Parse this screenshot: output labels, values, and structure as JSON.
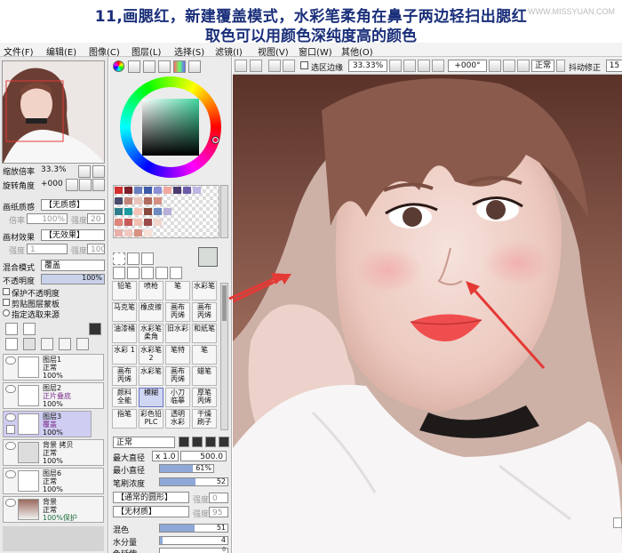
{
  "caption": {
    "line1": "11,画腮红，新建覆盖模式，水彩笔柔角在鼻子两边轻扫出腮红",
    "line2": "取色可以用颜色深纯度高的颜色",
    "watermark": "WWW.MISSYUAN.COM"
  },
  "menu": [
    "文件(F)",
    "编辑(E)",
    "图像(C)",
    "图层(L)",
    "选择(S)",
    "滤镜(I)",
    "视图(V)",
    "窗口(W)",
    "其他(O)"
  ],
  "toolbar": {
    "select_edge_label": "选区边缘",
    "zoom": "33.33%",
    "angle": "+000°",
    "mode": "正常",
    "stabilizer_label": "抖动修正",
    "stabilizer_value": "15"
  },
  "navigator": {
    "zoom_label": "缩放倍率",
    "zoom_value": "33.3%",
    "rotate_label": "旋转角度",
    "rotate_value": "+000"
  },
  "paper": {
    "texture_label": "画纸质感",
    "texture_value": "【无质感】",
    "scale_label": "倍率",
    "scale_value": "100%",
    "strength_label": "强度",
    "strength_value": "20",
    "effect_label": "画材效果",
    "effect_value": "【无效果】",
    "width_label": "宽度",
    "width_value": "1",
    "strength2_value": "100"
  },
  "layer_props": {
    "blend_label": "混合模式",
    "blend_value": "覆盖",
    "opacity_label": "不透明度",
    "opacity_value": "100%",
    "check1": "保护不透明度",
    "check2": "剪贴图层蒙板",
    "check3": "指定选取来源"
  },
  "layers": [
    {
      "name": "图层1",
      "mode": "正常",
      "opacity": "100%",
      "accent": "#000000"
    },
    {
      "name": "图层2",
      "mode": "正片叠底",
      "opacity": "100%",
      "accent": "#7a2c8c"
    },
    {
      "name": "图层3",
      "mode": "覆盖",
      "opacity": "100%",
      "accent": "#7a2c8c"
    },
    {
      "name": "背景 拷贝",
      "mode": "正常",
      "opacity": "100%",
      "accent": "#000000"
    },
    {
      "name": "图层6",
      "mode": "正常",
      "opacity": "100%",
      "accent": "#000000"
    },
    {
      "name": "背景",
      "mode": "正常",
      "opacity": "100%保护",
      "accent": "#1c6a3a"
    }
  ],
  "brushes": [
    [
      "铅笔",
      "喷枪",
      "笔",
      "水彩笔"
    ],
    [
      "马克笔",
      "橡皮擦",
      "画布 丙烯",
      "画布 丙烯"
    ],
    [
      "油漆桶",
      "水彩笔 柔角",
      "旧水彩",
      "和纸笔"
    ],
    [
      "水彩 1",
      "水彩笔 2",
      "笔特",
      "笔"
    ],
    [
      "画布 丙烯",
      "水彩笔",
      "画布 丙烯",
      "蜡笔"
    ],
    [
      "颜料 全能",
      "模糊",
      "小刀 临摹",
      "厚笔 丙烯"
    ],
    [
      "指笔",
      "彩色铅 PLC",
      "透明 水彩",
      "干燥 刷子"
    ]
  ],
  "brush_props": {
    "mode": "正常",
    "max_diameter_label": "最大直径",
    "max_diameter_scale": "x 1.0",
    "max_diameter_value": "500.0",
    "min_diameter_label": "最小直径",
    "min_diameter_value": "61%",
    "density_label": "笔刷浓度",
    "density_value": "52",
    "shape_value": "【通常的圆形】",
    "shape_strength_label": "强度",
    "shape_strength_value": "0",
    "texture_value": "【无材质】",
    "texture_strength_label": "强度",
    "texture_strength_value": "95",
    "blend_label": "混色",
    "blend_value": "51",
    "water_label": "水分量",
    "water_value": "4",
    "persist_label": "色延伸",
    "persist_value": "0"
  },
  "colors": {
    "accent_blue": "#1a2f7a",
    "arrow_red": "#e53935",
    "selection_purple": "#cfcdf1"
  }
}
